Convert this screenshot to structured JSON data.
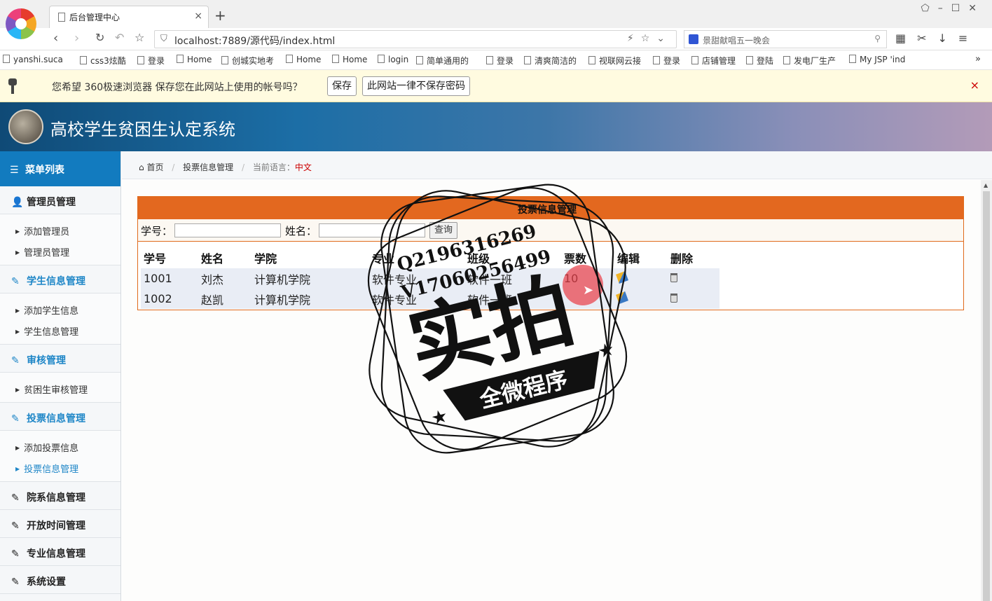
{
  "browser": {
    "tab_title": "后台管理中心",
    "tab_close": "×",
    "new_tab": "+",
    "url": "localhost:7889/源代码/index.html",
    "search_placeholder": "景甜献唱五一晚会",
    "bookmarks": [
      "yanshi.suca",
      "css3炫酷",
      "登录",
      "Home",
      "创城实地考",
      "Home",
      "Home",
      "login",
      "简单通用的",
      "登录",
      "清爽简洁的",
      "视联网云接",
      "登录",
      "店铺管理",
      "登陆",
      "发电厂生产",
      "My JSP 'ind"
    ],
    "bookmarks_more": "»"
  },
  "save_bar": {
    "message": "您希望 360极速浏览器 保存您在此网站上使用的帐号吗？",
    "save_label": "保存",
    "never_label": "此网站一律不保存密码",
    "close": "×"
  },
  "app": {
    "title": "高校学生贫困生认定系统"
  },
  "sidebar": {
    "menu_title": "菜单列表",
    "groups": [
      {
        "label": "管理员管理",
        "subs": [
          "添加管理员",
          "管理员管理"
        ]
      },
      {
        "label": "学生信息管理",
        "subs": [
          "添加学生信息",
          "学生信息管理"
        ]
      },
      {
        "label": "审核管理",
        "subs": [
          "贫困生审核管理"
        ]
      },
      {
        "label": "投票信息管理",
        "subs": [
          "添加投票信息",
          "投票信息管理"
        ]
      },
      {
        "label": "院系信息管理"
      },
      {
        "label": "开放时间管理"
      },
      {
        "label": "专业信息管理"
      },
      {
        "label": "系统设置"
      }
    ]
  },
  "breadcrumb": {
    "home": "首页",
    "section": "投票信息管理",
    "lang_label": "当前语言：",
    "lang_value": "中文"
  },
  "panel": {
    "title": "投票信息管理",
    "search": {
      "id_label": "学号：",
      "name_label": "姓名：",
      "query_label": "查询"
    },
    "columns": [
      "学号",
      "姓名",
      "学院",
      "专业",
      "班级",
      "票数",
      "编辑",
      "删除"
    ],
    "rows": [
      {
        "id": "1001",
        "name": "刘杰",
        "college": "计算机学院",
        "major": "软件专业",
        "class": "软件一班",
        "votes": "10"
      },
      {
        "id": "1002",
        "name": "赵凯",
        "college": "计算机学院",
        "major": "软件专业",
        "class": "软件一班",
        "votes": ""
      }
    ]
  },
  "watermark": {
    "qq": "Q2196316269",
    "wechat": "V17060256499",
    "main": "实拍",
    "banner": "全微程序"
  },
  "colors": {
    "header_blue": "#127bbf",
    "accent_orange": "#e3681f",
    "active_link": "#1e86c7"
  }
}
